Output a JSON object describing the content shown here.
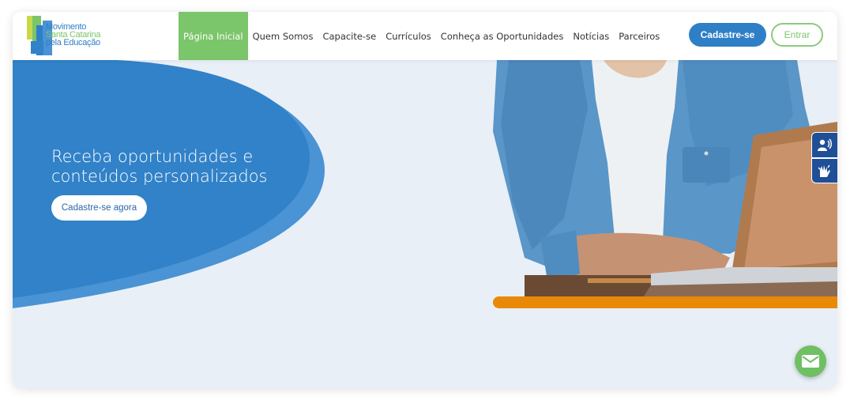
{
  "logo": {
    "line1": "Movimento",
    "line2": "Santa Catarina",
    "line3": "pela Educação",
    "colors": {
      "line1": "#2f7fc6",
      "line2": "#7bc56a",
      "line3": "#2f7fc6"
    }
  },
  "nav": {
    "items": [
      {
        "label": "Página Inicial",
        "active": true
      },
      {
        "label": "Quem Somos"
      },
      {
        "label": "Capacite-se"
      },
      {
        "label": "Currículos"
      },
      {
        "label": "Conheça as Oportunidades"
      },
      {
        "label": "Notícias"
      },
      {
        "label": "Parceiros"
      }
    ],
    "signup_label": "Cadastre-se",
    "login_label": "Entrar"
  },
  "hero": {
    "title_line1": "Receba oportunidades e",
    "title_line2": "conteúdos personalizados",
    "cta_label": "Cadastre-se agora"
  },
  "accessibility": {
    "icons": [
      "audio-description-icon",
      "sign-language-icon"
    ]
  },
  "floating": {
    "icon": "mail-icon"
  },
  "colors": {
    "brand_blue": "#2f7fc6",
    "brand_green": "#7bc56a",
    "hero_blue": "#3182c8",
    "accent_orange": "#e88a07",
    "background": "#e9eff7"
  }
}
